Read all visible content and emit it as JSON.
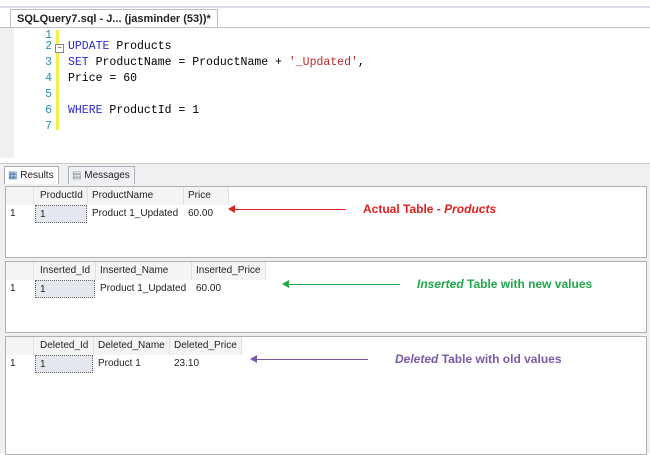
{
  "editor": {
    "tab_title": "SQLQuery7.sql - J... (jasminder (53))*",
    "lines": [
      {
        "n": "1"
      },
      {
        "n": "2",
        "kw": "UPDATE",
        "rest": " Products"
      },
      {
        "n": "3",
        "kw": "SET",
        "rest": " ProductName = ProductName + ",
        "str": "'_Updated'",
        "tail": ","
      },
      {
        "n": "4",
        "rest": "Price = 60"
      },
      {
        "n": "5"
      },
      {
        "n": "6",
        "kw": "WHERE",
        "rest": " ProductId = 1"
      },
      {
        "n": "7"
      }
    ]
  },
  "results": {
    "tabs": [
      {
        "label": "Results"
      },
      {
        "label": "Messages"
      }
    ],
    "grids": [
      {
        "headers": [
          "ProductId",
          "ProductName",
          "Price"
        ],
        "row_num": "1",
        "row": [
          "1",
          "Product 1_Updated",
          "60.00"
        ],
        "note": {
          "italic_part": "",
          "text1": "Actual Table - ",
          "italic": "Products",
          "color": "#e0201c"
        }
      },
      {
        "headers": [
          "Inserted_Id",
          "Inserted_Name",
          "Inserted_Price"
        ],
        "row_num": "1",
        "row": [
          "1",
          "Product 1_Updated",
          "60.00"
        ],
        "note": {
          "italic_first": "Inserted",
          "text": " Table with new values",
          "color": "#1fa84a"
        }
      },
      {
        "headers": [
          "Deleted_Id",
          "Deleted_Name",
          "Deleted_Price"
        ],
        "row_num": "1",
        "row": [
          "1",
          "Product 1",
          "23.10"
        ],
        "note": {
          "italic_first": "Deleted",
          "text": " Table with old values",
          "color": "#7a5aa8"
        }
      }
    ]
  }
}
